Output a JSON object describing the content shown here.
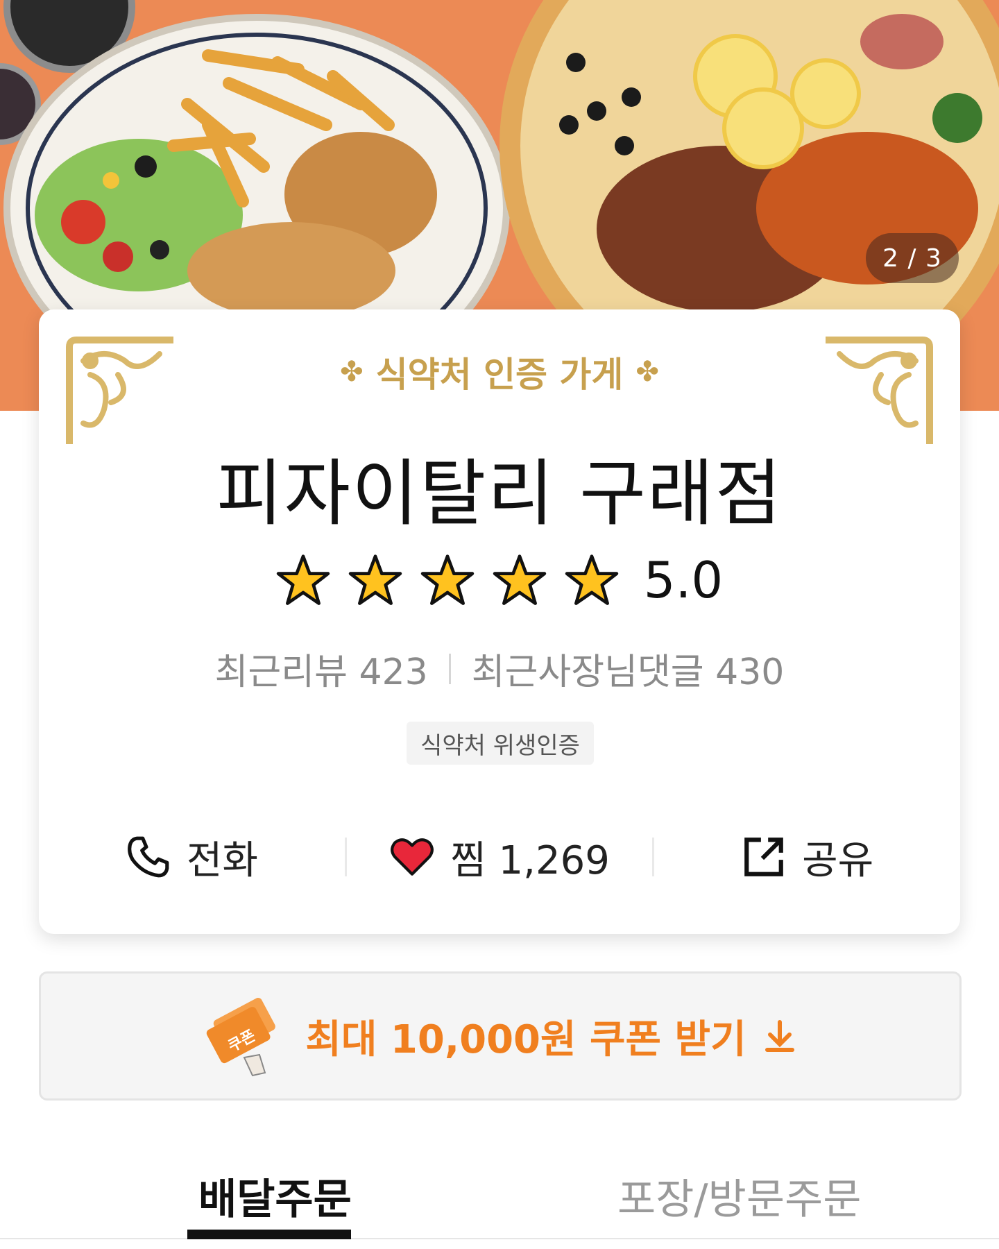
{
  "hero": {
    "pager": "2 / 3",
    "colors": {
      "background": "#ec8a55"
    }
  },
  "store": {
    "cert_banner": "식약처 인증 가게",
    "name": "피자이탈리 구래점",
    "rating_stars": 5,
    "rating": "5.0",
    "recent_reviews": "최근리뷰 423",
    "recent_owner_replies": "최근사장님댓글 430",
    "cert_badge": "식약처 위생인증",
    "icons": [
      "phone-icon",
      "heart-icon",
      "share-icon"
    ]
  },
  "actions": {
    "call": "전화",
    "favorite": "찜 1,269",
    "share": "공유"
  },
  "coupon": {
    "icon_label": "쿠폰",
    "label": "최대 10,000원 쿠폰 받기",
    "color": "#f07f1f"
  },
  "tabs": {
    "delivery": "배달주문",
    "pickup": "포장/방문주문"
  }
}
